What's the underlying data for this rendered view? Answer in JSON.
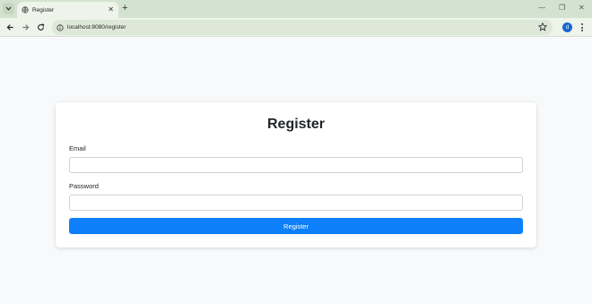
{
  "browser": {
    "tab_title": "Register",
    "tab_close": "✕",
    "new_tab": "+",
    "url": "localhost:8080/register",
    "profile_initial": "d",
    "controls": {
      "minimize": "—",
      "restore": "❐",
      "close": "✕"
    }
  },
  "form": {
    "title": "Register",
    "email_label": "Email",
    "email_value": "",
    "password_label": "Password",
    "password_value": "",
    "submit_label": "Register"
  },
  "colors": {
    "primary_button": "#0d7ff9",
    "tabbar": "#d3e3cf",
    "toolbar": "#eef4ea",
    "page_background": "#f8f9fa"
  }
}
